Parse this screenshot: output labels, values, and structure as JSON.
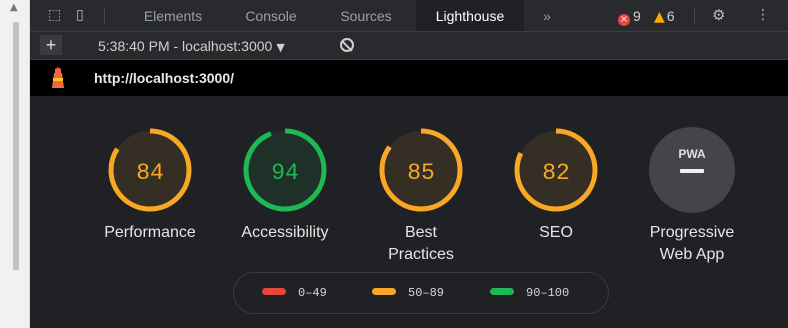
{
  "tabs": [
    {
      "label": "Elements",
      "active": false
    },
    {
      "label": "Console",
      "active": false
    },
    {
      "label": "Sources",
      "active": false
    },
    {
      "label": "Lighthouse",
      "active": true
    }
  ],
  "more_tabs": "»",
  "errors": "9",
  "warnings": "6",
  "toolbar": {
    "plus": "+",
    "report_label": "5:38:40 PM - localhost:3000"
  },
  "url": "http://localhost:3000/",
  "scores": [
    {
      "score": 84,
      "label": "Performance",
      "label2": "",
      "color": "#f9a825"
    },
    {
      "score": 94,
      "label": "Accessibility",
      "label2": "",
      "color": "#1db954"
    },
    {
      "score": 85,
      "label": "Best",
      "label2": "Practices",
      "color": "#f9a825"
    },
    {
      "score": 82,
      "label": "SEO",
      "label2": "",
      "color": "#f9a825"
    }
  ],
  "pwa": {
    "badge": "PWA",
    "label": "Progressive",
    "label2": "Web App"
  },
  "legend": [
    {
      "range": "0–49",
      "color": "#e8453c"
    },
    {
      "range": "50–89",
      "color": "#f9a825"
    },
    {
      "range": "90–100",
      "color": "#1db954"
    }
  ],
  "colors": {
    "fail": "#e8453c",
    "average": "#f9a825",
    "pass": "#1db954"
  }
}
